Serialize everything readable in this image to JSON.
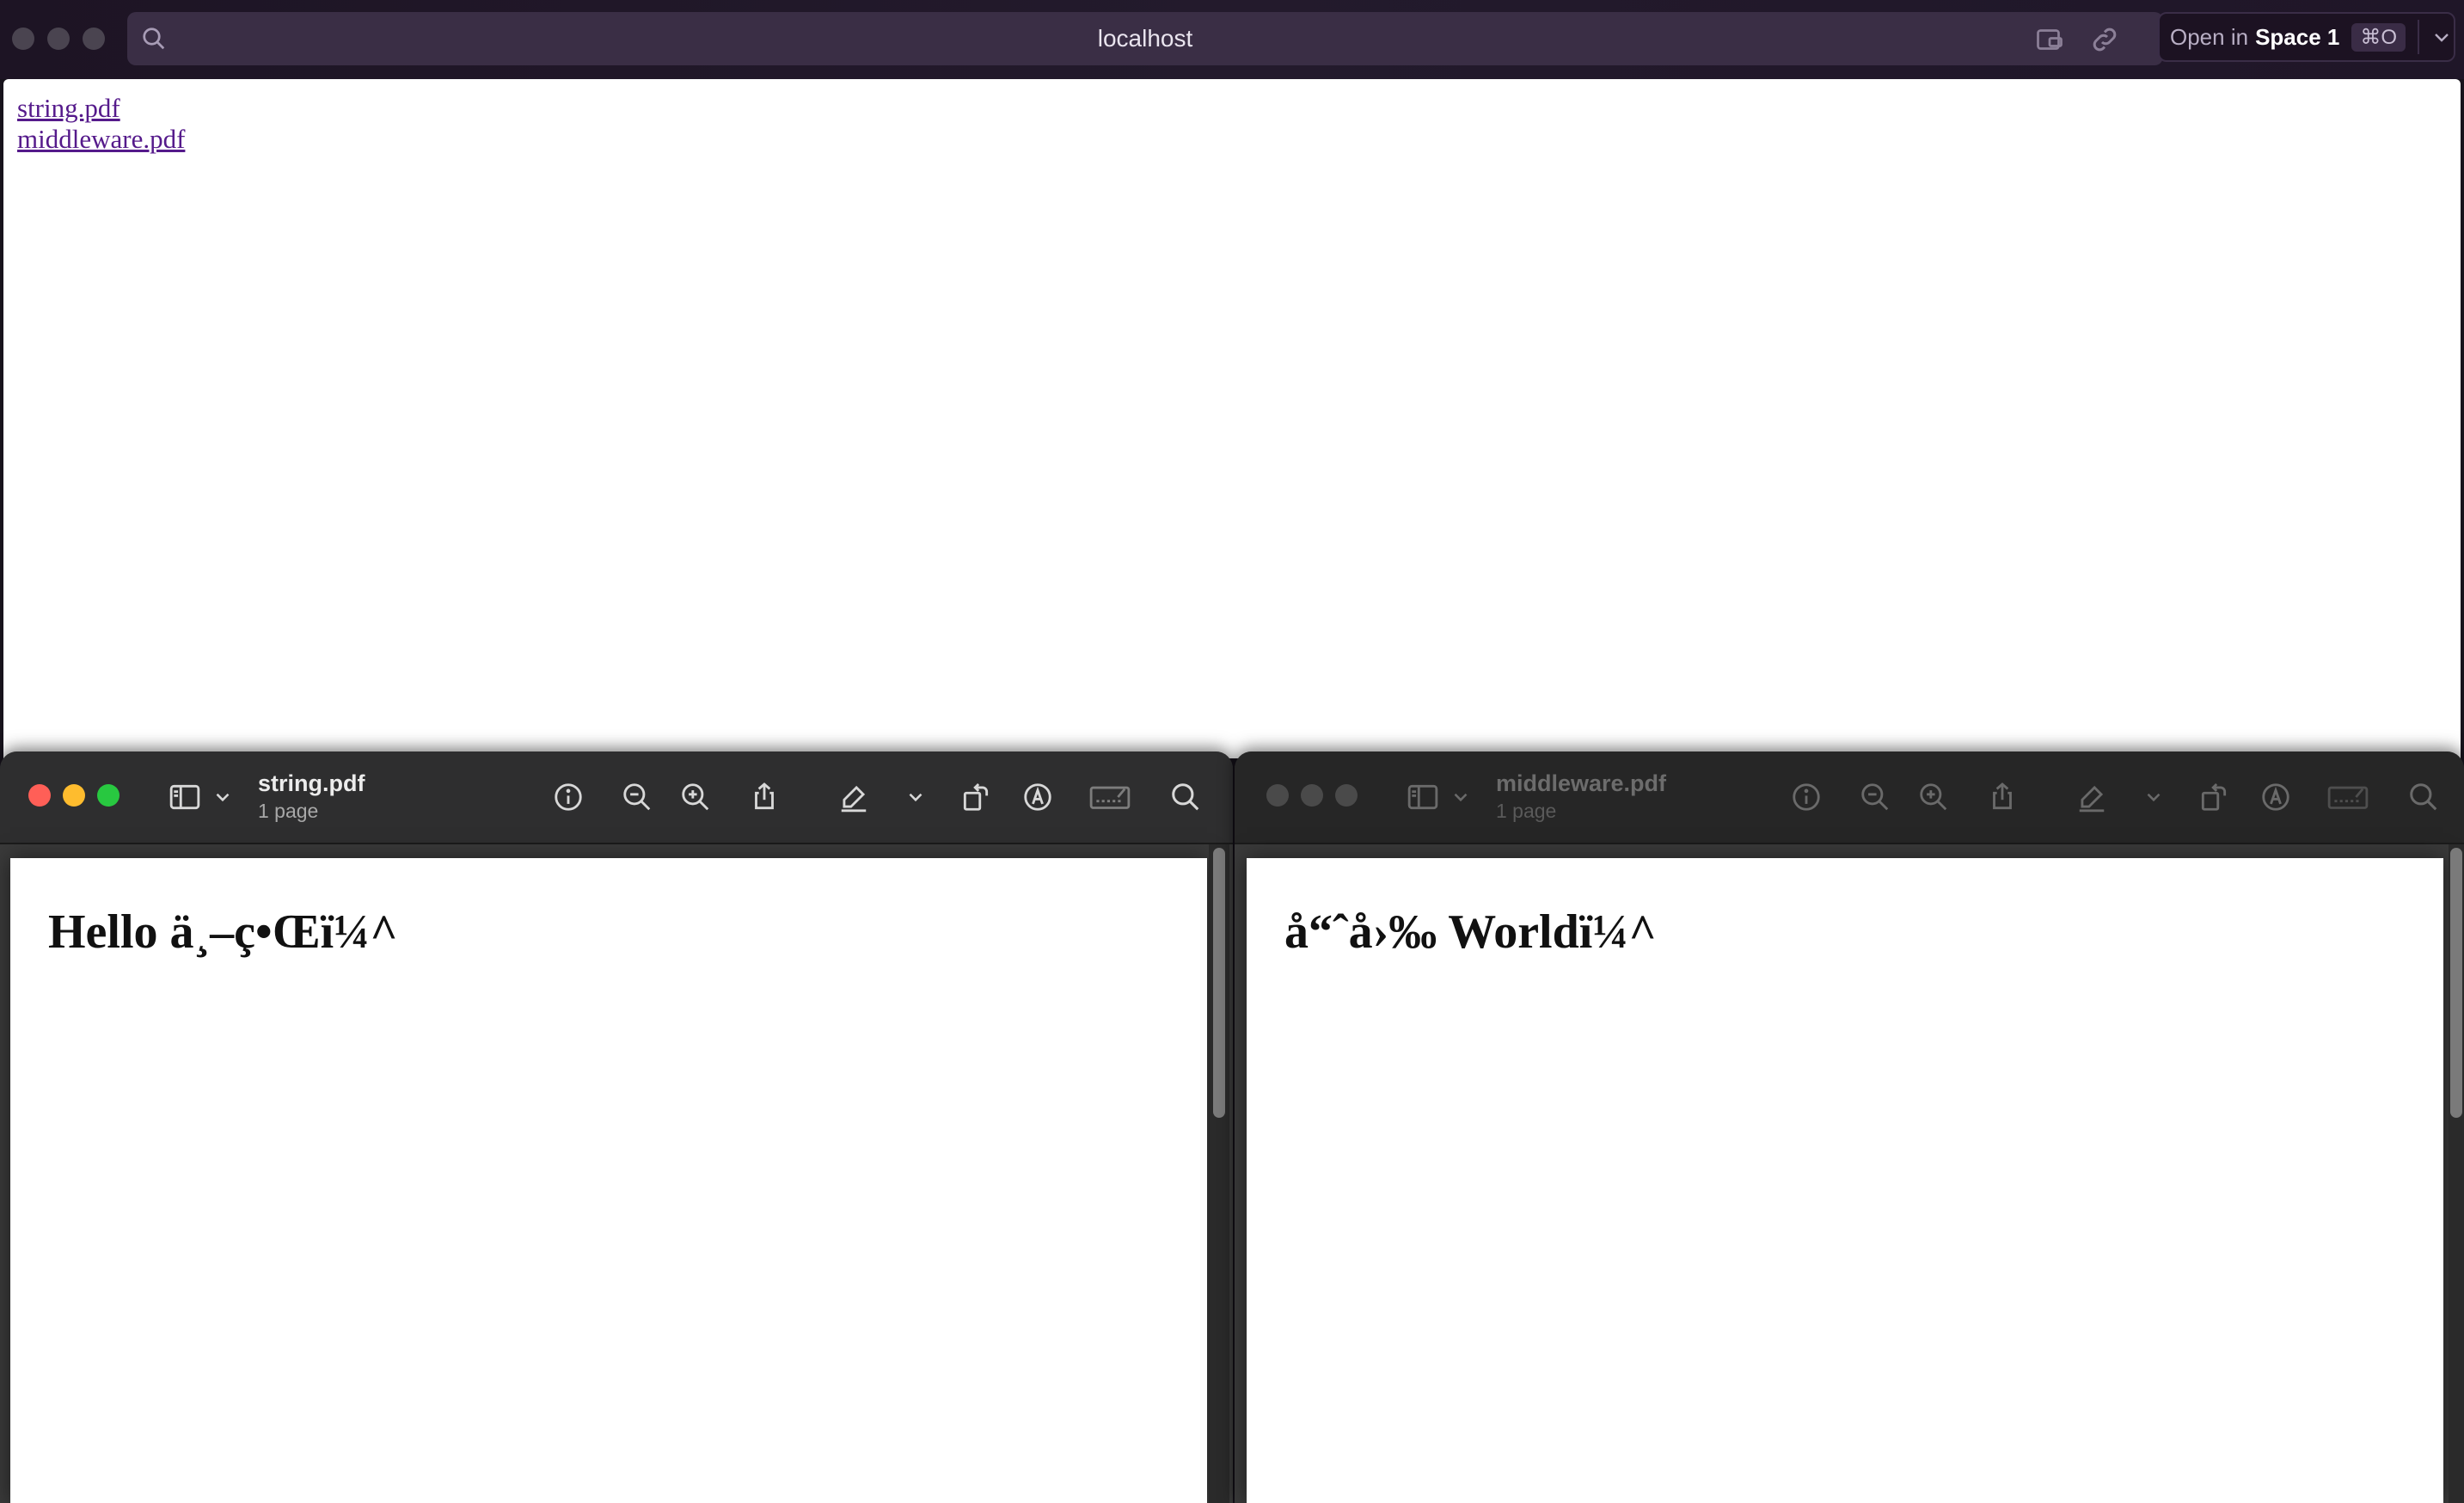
{
  "browser": {
    "url": "localhost",
    "open_in_prefix": "Open in",
    "open_in_space": "Space 1",
    "open_in_shortcut": "⌘O",
    "links": [
      "string.pdf",
      "middleware.pdf"
    ]
  },
  "preview_left": {
    "title": "string.pdf",
    "subtitle": "1 page",
    "content": "Hello ä¸–ç•Œï¼^",
    "active": true
  },
  "preview_right": {
    "title": "middleware.pdf",
    "subtitle": "1 page",
    "content": "å“ˆå›‰ Worldï¼^",
    "active": false
  },
  "colors": {
    "close": "#ff5f57",
    "minimize": "#febc2e",
    "zoom": "#28c840",
    "link": "#551a8b"
  },
  "icons": [
    "search-icon",
    "sidebar-icon",
    "info-icon",
    "zoom-out-icon",
    "zoom-in-icon",
    "share-icon",
    "highlight-icon",
    "rotate-icon",
    "markup-icon",
    "signature-icon"
  ]
}
